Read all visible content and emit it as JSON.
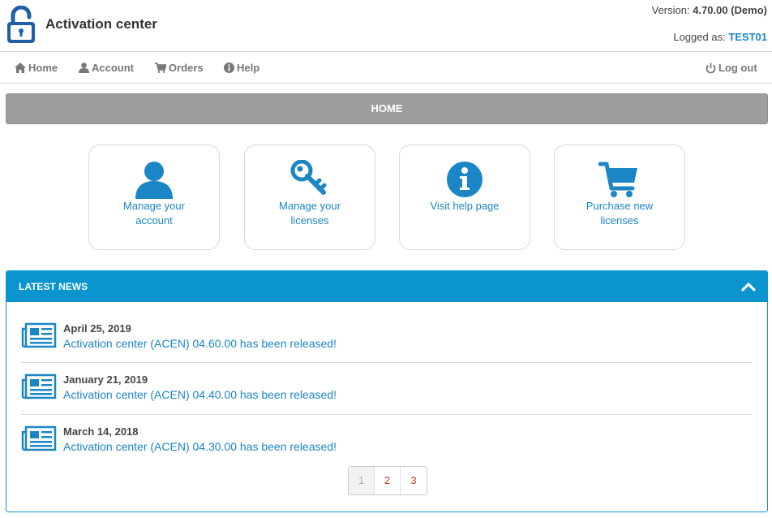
{
  "header": {
    "app_title": "Activation center",
    "version_label": "Version:",
    "version_value": "4.70.00 (Demo)",
    "logged_label": "Logged as:",
    "logged_user": "TEST01"
  },
  "nav": {
    "home": "Home",
    "account": "Account",
    "orders": "Orders",
    "help": "Help",
    "logout": "Log out"
  },
  "page_bar": "HOME",
  "tiles": [
    {
      "line1": "Manage your",
      "line2": "account",
      "icon": "user-icon"
    },
    {
      "line1": "Manage your",
      "line2": "licenses",
      "icon": "key-icon"
    },
    {
      "line1": "Visit help page",
      "line2": "",
      "icon": "info-icon"
    },
    {
      "line1": "Purchase new",
      "line2": "licenses",
      "icon": "cart-icon"
    }
  ],
  "news": {
    "title": "LATEST NEWS",
    "items": [
      {
        "date": "April 25, 2019",
        "title": "Activation center (ACEN) 04.60.00 has been released!"
      },
      {
        "date": "January 21, 2019",
        "title": "Activation center (ACEN) 04.40.00 has been released!"
      },
      {
        "date": "March 14, 2018",
        "title": "Activation center (ACEN) 04.30.00 has been released!"
      }
    ],
    "pages": [
      "1",
      "2",
      "3"
    ],
    "current_page": "1"
  },
  "colors": {
    "accent": "#0b95cf",
    "link": "#1b86c6",
    "page_bar": "#9e9e9e"
  }
}
